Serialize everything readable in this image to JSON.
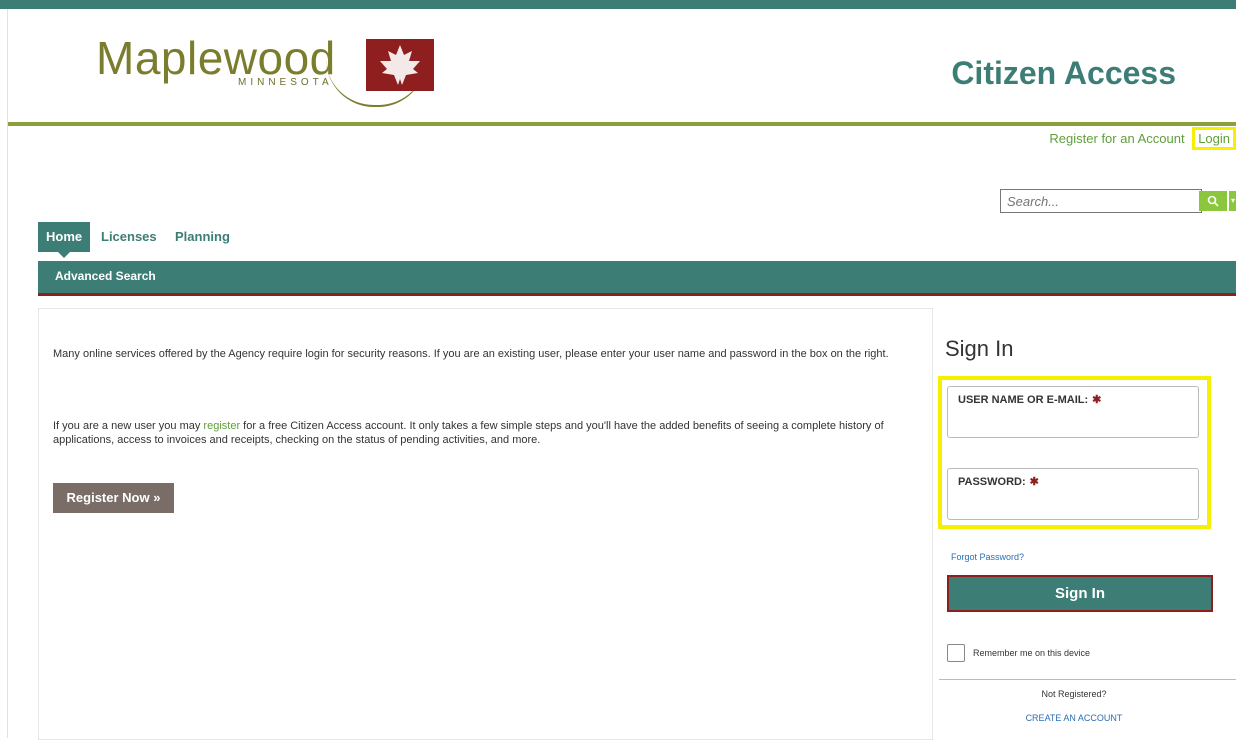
{
  "brand": {
    "logo_text": "Maplewood",
    "logo_sub": "MINNESOTA",
    "app_title": "Citizen Access"
  },
  "utility": {
    "register_link": "Register for an Account",
    "login_link": "Login"
  },
  "search": {
    "placeholder": "Search..."
  },
  "tabs": [
    {
      "label": "Home",
      "active": true
    },
    {
      "label": "Licenses",
      "active": false
    },
    {
      "label": "Planning",
      "active": false
    }
  ],
  "subnav": {
    "item": "Advanced Search"
  },
  "main": {
    "paragraph1": "Many online services offered by the Agency require login for security reasons. If you are an existing user, please enter your user name and password in the box on the right.",
    "paragraph2_before": "If you are a new user you may ",
    "paragraph2_link": "register",
    "paragraph2_after": " for a free Citizen Access account. It only takes a few simple steps and you'll have the added benefits of seeing a complete history of applications, access to invoices and receipts, checking on the status of pending activities, and more.",
    "register_button": "Register Now »"
  },
  "signin": {
    "title": "Sign In",
    "username_label": "USER NAME OR E-MAIL:",
    "password_label": "PASSWORD:",
    "required_mark": "✱",
    "forgot": "Forgot Password?",
    "button": "Sign In",
    "remember": "Remember me on this device",
    "not_registered": "Not Registered?",
    "create_account": "CREATE AN ACCOUNT"
  },
  "colors": {
    "teal": "#3c7d76",
    "green_accent": "#8aa03a",
    "link_green": "#5fa03a",
    "maroon": "#8f1f1f",
    "highlight": "#f4f000"
  }
}
